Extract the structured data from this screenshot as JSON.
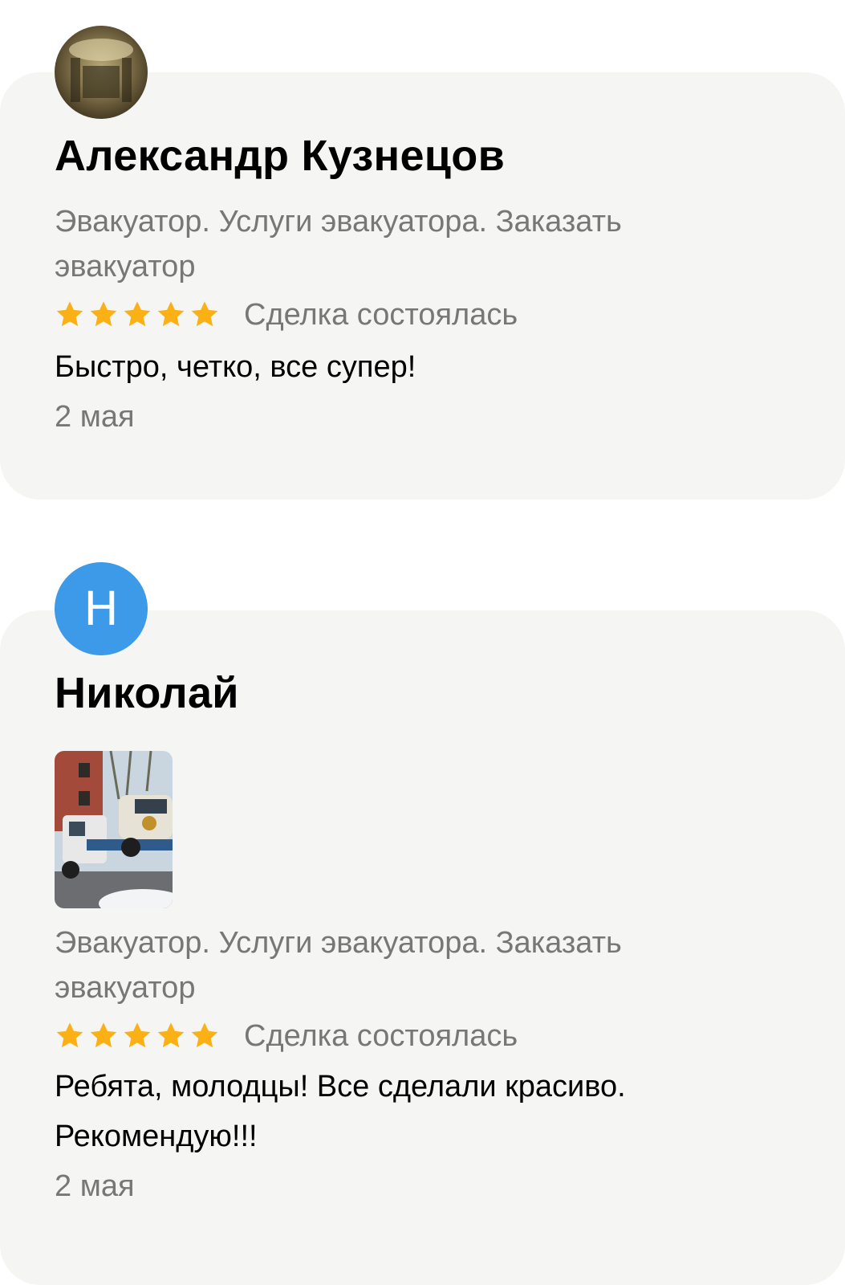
{
  "reviews": [
    {
      "author": "Александр Кузнецов",
      "service": "Эвакуатор. Услуги эвакуатора. Заказать эвакуатор",
      "rating": 5,
      "deal_status": "Сделка состоялась",
      "text": "Быстро, четко, все супер!",
      "date": "2 мая"
    },
    {
      "author": "Николай",
      "avatar_letter": "Н",
      "service": "Эвакуатор. Услуги эвакуатора. Заказать эвакуатор",
      "rating": 5,
      "deal_status": "Сделка состоялась",
      "text": "Ребята, молодцы! Все сделали красиво. Рекомендую!!!",
      "date": "2 мая"
    }
  ],
  "colors": {
    "card_bg": "#f5f5f3",
    "star": "#fbb015",
    "secondary_text": "#777777",
    "avatar_blue": "#3d9ae8"
  }
}
